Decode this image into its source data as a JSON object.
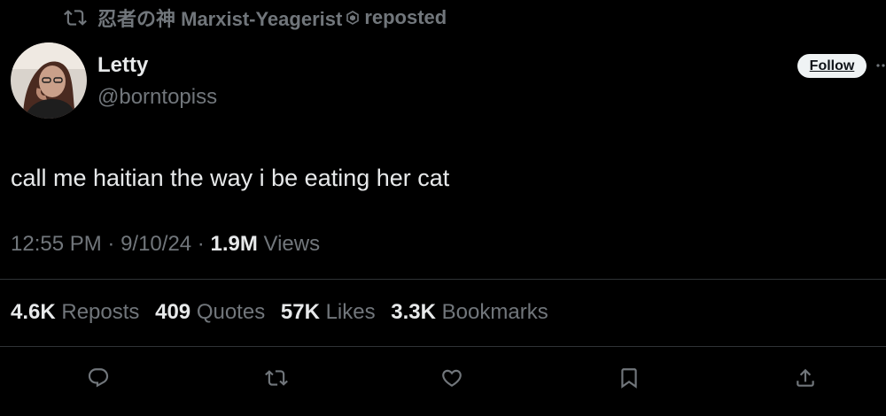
{
  "repost": {
    "user": "忍者の神 Marxist-Yeagerist",
    "suffix": "reposted",
    "icon": "repost-icon",
    "badge_icon": "hexagon-badge-icon"
  },
  "author": {
    "name": "Letty",
    "handle": "@borntopiss",
    "avatar": "avatar-photo"
  },
  "follow_label": "Follow",
  "more_icon": "more-dots-icon",
  "tweet": {
    "text": "call me haitian the way i be eating her cat"
  },
  "meta": {
    "time": "12:55 PM",
    "separator": " · ",
    "date": "9/10/24",
    "views_count": "1.9M",
    "views_label": "Views"
  },
  "stats": [
    {
      "count": "4.6K",
      "label": "Reposts"
    },
    {
      "count": "409",
      "label": "Quotes"
    },
    {
      "count": "57K",
      "label": "Likes"
    },
    {
      "count": "3.3K",
      "label": "Bookmarks"
    }
  ],
  "actions": [
    "reply-icon",
    "repost-icon",
    "like-icon",
    "bookmark-icon",
    "share-icon"
  ],
  "colors": {
    "background": "#000000",
    "primary_text": "#e7e9ea",
    "secondary_text": "#71767b",
    "divider": "#2f3336",
    "follow_bg": "#eff3f4"
  }
}
